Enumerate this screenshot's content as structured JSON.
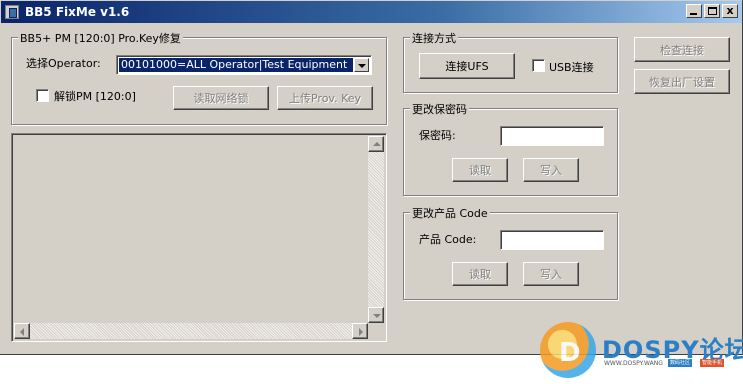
{
  "window": {
    "title": "BB5 FixMe v1.6",
    "controls": {
      "minimize": "_",
      "maximize": "□",
      "close": "x"
    }
  },
  "pm_group": {
    "title": "BB5+ PM [120:0] Pro.Key修复",
    "operator_label": "选择Operator:",
    "operator_value": "00101000=ALL Operator|Test Equipment",
    "unlock_label": "解锁PM [120:0]",
    "read_lock_button": "读取网络锁",
    "upload_button": "上传Prov. Key"
  },
  "connect_group": {
    "title": "连接方式",
    "ufs_button": "连接UFS",
    "usb_label": "USB连接"
  },
  "right_buttons": {
    "check_connection": "检查连接",
    "restore_factory": "恢复出厂设置"
  },
  "security_group": {
    "title": "更改保密码",
    "code_label": "保密码:",
    "code_value": "",
    "read_button": "读取",
    "write_button": "写入"
  },
  "product_group": {
    "title": "更改产品 Code",
    "code_label": "产品 Code:",
    "code_value": "",
    "read_button": "读取",
    "write_button": "写入"
  },
  "watermark": {
    "brand": "DOSPY论坛",
    "url": "WWW.DOSPY.WANG",
    "tag1": "数码社区",
    "tag2": "智能手机"
  },
  "colors": {
    "face": "#d4d0c8",
    "titlebar_start": "#0a246a",
    "titlebar_end": "#a6caf0",
    "selection": "#0a246a"
  }
}
